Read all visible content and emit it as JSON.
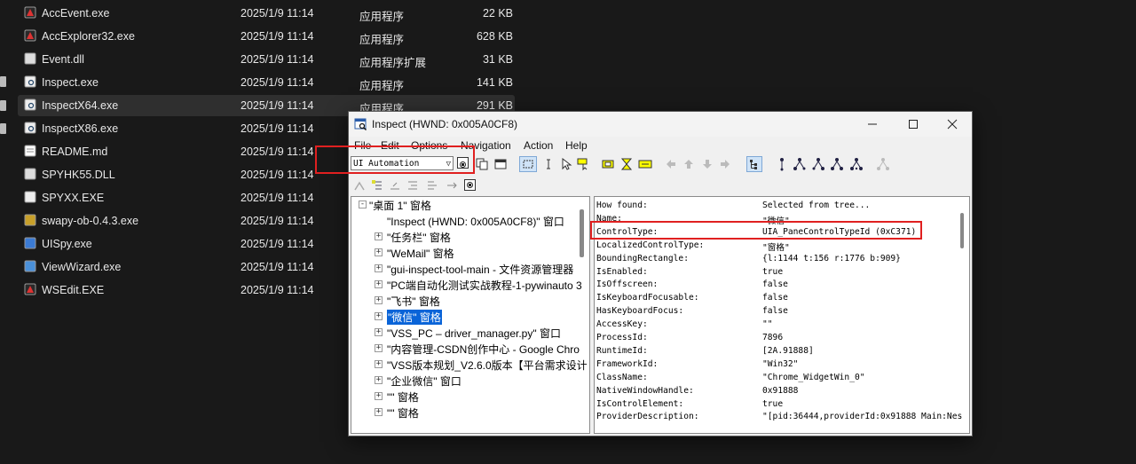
{
  "explorer": {
    "files": [
      {
        "name": "AccEvent.exe",
        "date": "2025/1/9 11:14",
        "type": "应用程序",
        "size": "22 KB",
        "icon": "app-icon"
      },
      {
        "name": "AccExplorer32.exe",
        "date": "2025/1/9 11:14",
        "type": "应用程序",
        "size": "628 KB",
        "icon": "app-icon"
      },
      {
        "name": "Event.dll",
        "date": "2025/1/9 11:14",
        "type": "应用程序扩展",
        "size": "31 KB",
        "icon": "dll-icon"
      },
      {
        "name": "Inspect.exe",
        "date": "2025/1/9 11:14",
        "type": "应用程序",
        "size": "141 KB",
        "icon": "inspect-icon"
      },
      {
        "name": "InspectX64.exe",
        "date": "2025/1/9 11:14",
        "type": "应用程序",
        "size": "291 KB",
        "icon": "inspect-icon"
      },
      {
        "name": "InspectX86.exe",
        "date": "2025/1/9 11:14",
        "type": "",
        "size": "",
        "icon": "inspect-icon"
      },
      {
        "name": "README.md",
        "date": "2025/1/9 11:14",
        "type": "",
        "size": "",
        "icon": "document-icon"
      },
      {
        "name": "SPYHK55.DLL",
        "date": "2025/1/9 11:14",
        "type": "",
        "size": "",
        "icon": "dll-icon"
      },
      {
        "name": "SPYXX.EXE",
        "date": "2025/1/9 11:14",
        "type": "",
        "size": "",
        "icon": "spy-icon"
      },
      {
        "name": "swapy-ob-0.4.3.exe",
        "date": "2025/1/9 11:14",
        "type": "",
        "size": "",
        "icon": "python-icon"
      },
      {
        "name": "UISpy.exe",
        "date": "2025/1/9 11:14",
        "type": "",
        "size": "",
        "icon": "uispy-icon"
      },
      {
        "name": "ViewWizard.exe",
        "date": "2025/1/9 11:14",
        "type": "",
        "size": "",
        "icon": "wizard-icon"
      },
      {
        "name": "WSEdit.EXE",
        "date": "2025/1/9 11:14",
        "type": "",
        "size": "",
        "icon": "app-icon"
      }
    ]
  },
  "inspect": {
    "title": "Inspect  (HWND: 0x005A0CF8)",
    "menus": [
      "File",
      "Edit",
      "Options",
      "Navigation",
      "Action",
      "Help"
    ],
    "mode": "UI Automation",
    "tree": [
      {
        "label": "\"桌面 1\" 窗格",
        "level": 0,
        "box": "-"
      },
      {
        "label": "\"Inspect  (HWND: 0x005A0CF8)\" 窗口",
        "level": 1,
        "box": ""
      },
      {
        "label": "\"任务栏\" 窗格",
        "level": 1,
        "box": "+"
      },
      {
        "label": "\"WeMail\" 窗格",
        "level": 1,
        "box": "+"
      },
      {
        "label": "\"gui-inspect-tool-main - 文件资源管理器",
        "level": 1,
        "box": "+"
      },
      {
        "label": "\"PC端自动化测试实战教程-1-pywinauto 3",
        "level": 1,
        "box": "+"
      },
      {
        "label": "\"飞书\" 窗格",
        "level": 1,
        "box": "+"
      },
      {
        "label": "\"微信\" 窗格",
        "level": 1,
        "box": "+",
        "selected": true
      },
      {
        "label": "\"VSS_PC – driver_manager.py\" 窗口",
        "level": 1,
        "box": "+"
      },
      {
        "label": "\"内容管理-CSDN创作中心 - Google Chro",
        "level": 1,
        "box": "+"
      },
      {
        "label": "\"VSS版本规划_V2.6.0版本【平台需求设计",
        "level": 1,
        "box": "+"
      },
      {
        "label": "\"企业微信\" 窗口",
        "level": 1,
        "box": "+"
      },
      {
        "label": "\"\" 窗格",
        "level": 1,
        "box": "+"
      },
      {
        "label": "\"\" 窗格",
        "level": 1,
        "box": "+"
      }
    ],
    "properties": [
      {
        "k": "How found:",
        "v": "Selected from tree..."
      },
      {
        "k": "Name:",
        "v": "\"微信\""
      },
      {
        "k": "ControlType:",
        "v": "UIA_PaneControlTypeId (0xC371)"
      },
      {
        "k": "LocalizedControlType:",
        "v": "\"窗格\""
      },
      {
        "k": "BoundingRectangle:",
        "v": "{l:1144 t:156 r:1776 b:909}"
      },
      {
        "k": "IsEnabled:",
        "v": "true"
      },
      {
        "k": "IsOffscreen:",
        "v": "false"
      },
      {
        "k": "IsKeyboardFocusable:",
        "v": "false"
      },
      {
        "k": "HasKeyboardFocus:",
        "v": "false"
      },
      {
        "k": "AccessKey:",
        "v": "\"\""
      },
      {
        "k": "ProcessId:",
        "v": "7896"
      },
      {
        "k": "RuntimeId:",
        "v": "[2A.91888]"
      },
      {
        "k": "FrameworkId:",
        "v": "\"Win32\""
      },
      {
        "k": "ClassName:",
        "v": "\"Chrome_WidgetWin_0\""
      },
      {
        "k": "NativeWindowHandle:",
        "v": "0x91888"
      },
      {
        "k": "IsControlElement:",
        "v": "true"
      },
      {
        "k": "ProviderDescription:",
        "v": "\"[pid:36444,providerId:0x91888 Main:Nes"
      }
    ]
  }
}
